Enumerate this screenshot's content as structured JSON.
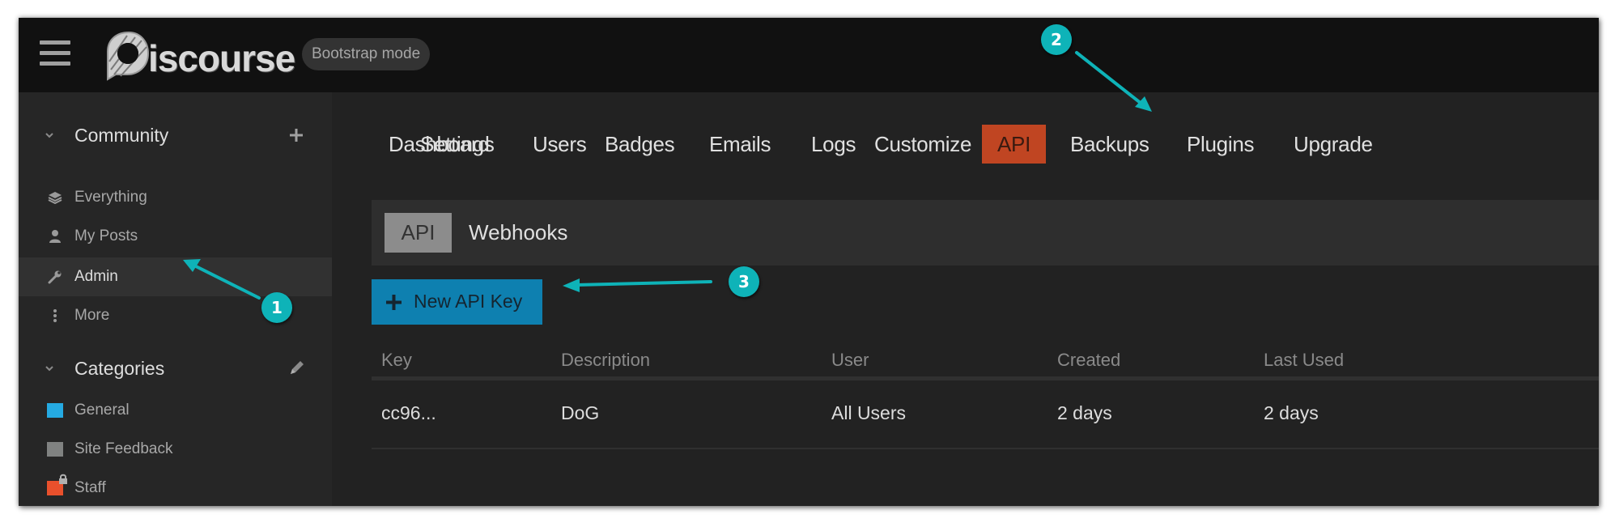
{
  "header": {
    "logo_text": "iscourse",
    "logo_alt": "Discourse",
    "mode_badge": "Bootstrap mode"
  },
  "sidebar": {
    "community": {
      "title": "Community",
      "action_icon": "plus-icon",
      "items": [
        {
          "label": "Everything",
          "icon": "layers-icon",
          "active": false
        },
        {
          "label": "My Posts",
          "icon": "user-icon",
          "active": false
        },
        {
          "label": "Admin",
          "icon": "wrench-icon",
          "active": true
        },
        {
          "label": "More",
          "icon": "ellipsis-vertical-icon",
          "active": false
        }
      ]
    },
    "categories": {
      "title": "Categories",
      "action_icon": "pencil-icon",
      "items": [
        {
          "label": "General",
          "color": "#25aae2",
          "locked": false
        },
        {
          "label": "Site Feedback",
          "color": "#808281",
          "locked": false
        },
        {
          "label": "Staff",
          "color": "#e9502c",
          "locked": true
        }
      ]
    }
  },
  "admin_nav": {
    "items": [
      {
        "label": "Dashboard",
        "active": false
      },
      {
        "label": "Settings",
        "active": false
      },
      {
        "label": "Users",
        "active": false
      },
      {
        "label": "Badges",
        "active": false
      },
      {
        "label": "Emails",
        "active": false
      },
      {
        "label": "Logs",
        "active": false
      },
      {
        "label": "Customize",
        "active": false
      },
      {
        "label": "API",
        "active": true
      },
      {
        "label": "Backups",
        "active": false
      },
      {
        "label": "Plugins",
        "active": false
      },
      {
        "label": "Upgrade",
        "active": false
      }
    ]
  },
  "subnav": {
    "items": [
      {
        "label": "API",
        "active": true
      },
      {
        "label": "Webhooks",
        "active": false
      }
    ]
  },
  "new_key_button": {
    "label": "New API Key",
    "icon": "plus-icon"
  },
  "api_keys_table": {
    "columns": [
      "Key",
      "Description",
      "User",
      "Created",
      "Last Used"
    ],
    "rows": [
      [
        "cc96...",
        "DoG",
        "All Users",
        "2 days",
        "2 days"
      ]
    ]
  },
  "annotations": [
    {
      "number": "1",
      "target": "Admin"
    },
    {
      "number": "2",
      "target": "API"
    },
    {
      "number": "3",
      "target": "New API Key"
    }
  ],
  "colors": {
    "accent_annotation": "#0eb3b8",
    "active_tab": "#c04522",
    "primary_button": "#0e80b0",
    "header_bg": "#111111",
    "sidebar_bg": "#262626",
    "main_bg": "#222222"
  }
}
